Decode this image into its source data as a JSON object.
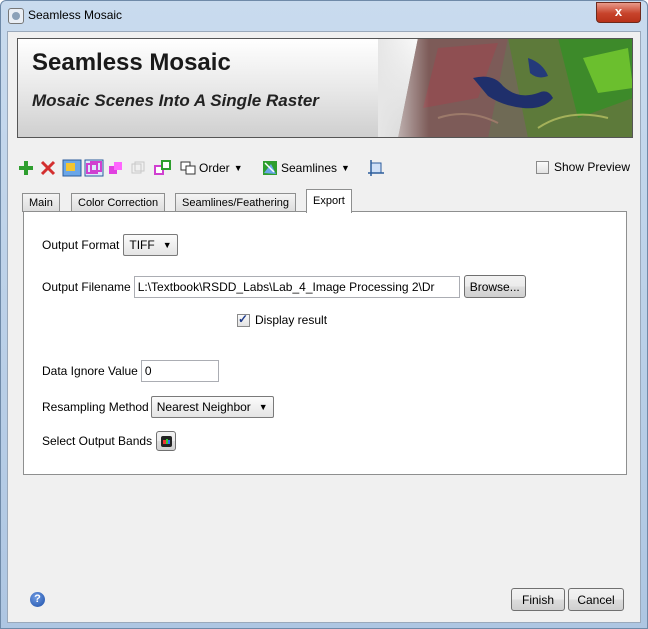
{
  "window": {
    "title": "Seamless Mosaic",
    "close_glyph": "x"
  },
  "banner": {
    "title": "Seamless Mosaic",
    "subtitle": "Mosaic Scenes Into A Single Raster"
  },
  "toolbar": {
    "icons": [
      "add-icon",
      "remove-icon",
      "select-footprint-icon",
      "show-footprint-icon",
      "color-icon",
      "disabled-layer-icon",
      "overlap-icon"
    ],
    "order_label": "Order",
    "seamlines_label": "Seamlines",
    "show_preview_label": "Show Preview",
    "show_preview_checked": false
  },
  "tabs": [
    {
      "label": "Main"
    },
    {
      "label": "Color Correction"
    },
    {
      "label": "Seamlines/Feathering"
    },
    {
      "label": "Export",
      "active": true
    }
  ],
  "export": {
    "output_format_label": "Output Format",
    "output_format_value": "TIFF",
    "output_filename_label": "Output Filename",
    "output_filename_value": "L:\\Textbook\\RSDD_Labs\\Lab_4_Image Processing 2\\Dr",
    "browse_label": "Browse...",
    "display_result_label": "Display result",
    "display_result_checked": true,
    "data_ignore_label": "Data Ignore Value",
    "data_ignore_value": "0",
    "resampling_label": "Resampling Method",
    "resampling_value": "Nearest Neighbor",
    "output_bands_label": "Select Output Bands"
  },
  "footer": {
    "help_glyph": "?",
    "finish_label": "Finish",
    "cancel_label": "Cancel"
  },
  "colors": {
    "accent_green": "#2e9e2e",
    "remove_red": "#d32f2f",
    "tab_border": "#8e8f8f"
  }
}
